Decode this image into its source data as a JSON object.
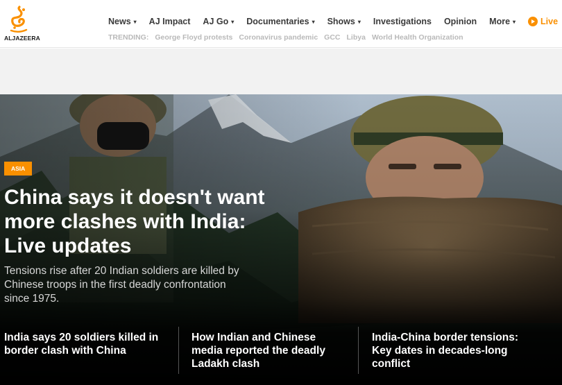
{
  "logo": {
    "text": "ALJAZEERA"
  },
  "nav": {
    "items": [
      {
        "label": "News",
        "dropdown": true
      },
      {
        "label": "AJ Impact",
        "dropdown": false
      },
      {
        "label": "AJ Go",
        "dropdown": true
      },
      {
        "label": "Documentaries",
        "dropdown": true
      },
      {
        "label": "Shows",
        "dropdown": true
      },
      {
        "label": "Investigations",
        "dropdown": false
      },
      {
        "label": "Opinion",
        "dropdown": false
      },
      {
        "label": "More",
        "dropdown": true
      }
    ],
    "live_label": "Live",
    "caret": "▾"
  },
  "trending": {
    "label": "TRENDING:",
    "topics": [
      "George Floyd protests",
      "Coronavirus pandemic",
      "GCC",
      "Libya",
      "World Health Organization"
    ]
  },
  "hero": {
    "tag": "ASIA",
    "headline": "China says it doesn't want more clashes with India: Live updates",
    "dek": "Tensions rise after 20 Indian soldiers are killed by Chinese troops in the first deadly confrontation since 1975."
  },
  "related": [
    "India says 20 soldiers killed in border clash with China",
    "How Indian and Chinese media reported the deadly Ladakh clash",
    "India-China border tensions: Key dates in decades-long conflict"
  ],
  "colors": {
    "accent": "#fa9000",
    "nav_text": "#3a3a3a",
    "trending_text": "#b9b9b9"
  }
}
